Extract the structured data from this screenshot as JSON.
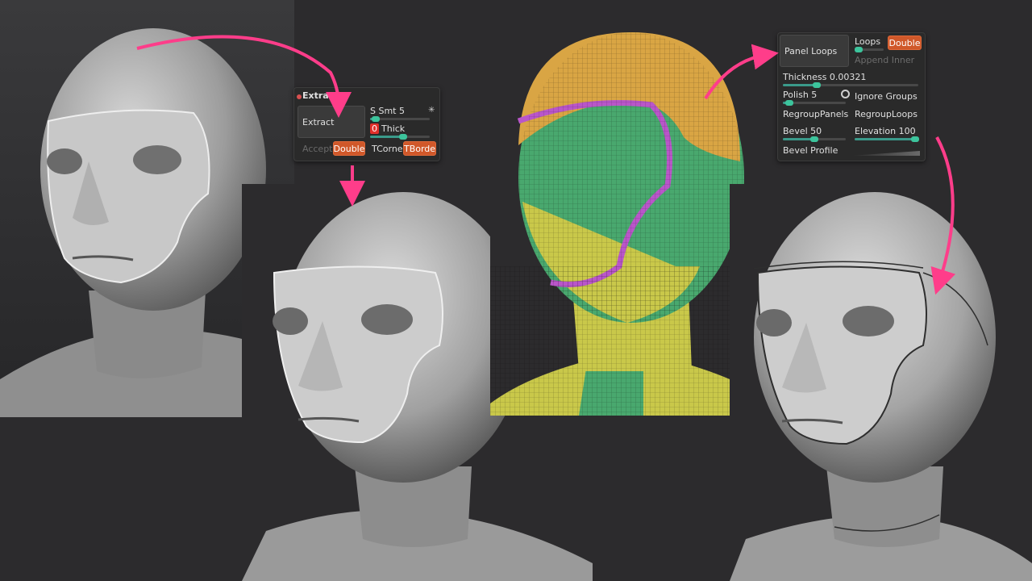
{
  "extract_panel": {
    "title": "Extract",
    "extract_button": "Extract",
    "s_smt_label": "S Smt",
    "s_smt_value": "5",
    "s_smt_level": 0.1,
    "thick_prefix": "0",
    "thick_label": "Thick",
    "thick_level": 0.55,
    "accept_button": "Accept",
    "double_button": "Double",
    "tcorne_button": "TCorne",
    "tborde_button": "TBorde"
  },
  "panel_loops": {
    "panel_loops_button": "Panel Loops",
    "loops_label": "Loops",
    "loops_level": 0.1,
    "double_button": "Double",
    "append_inner": "Append Inner",
    "thickness_label": "Thickness",
    "thickness_value": "0.00321",
    "thickness_level": 0.25,
    "polish_label": "Polish",
    "polish_value": "5",
    "polish_level": 0.1,
    "ignore_groups": "Ignore Groups",
    "regroup_panels": "RegroupPanels",
    "regroup_loops": "RegroupLoops",
    "bevel_label": "Bevel",
    "bevel_value": "50",
    "bevel_level": 0.5,
    "elevation_label": "Elevation",
    "elevation_value": "100",
    "elevation_level": 1.0,
    "bevel_profile": "Bevel Profile"
  },
  "colors": {
    "background": "#2c2b2d",
    "arrow": "#ff3d8a",
    "accent_orange": "#d0582a",
    "slider_green": "#3cc49c",
    "mesh_orange": "#d9a544",
    "mesh_green": "#49a86e",
    "mesh_yellow": "#c9c84a",
    "mesh_purple": "#b956c9"
  },
  "icons": {
    "annotation": "curved-arrow-icon",
    "panel_marker": "dot-icon",
    "radio": "radio-icon",
    "pin": "star-icon"
  }
}
